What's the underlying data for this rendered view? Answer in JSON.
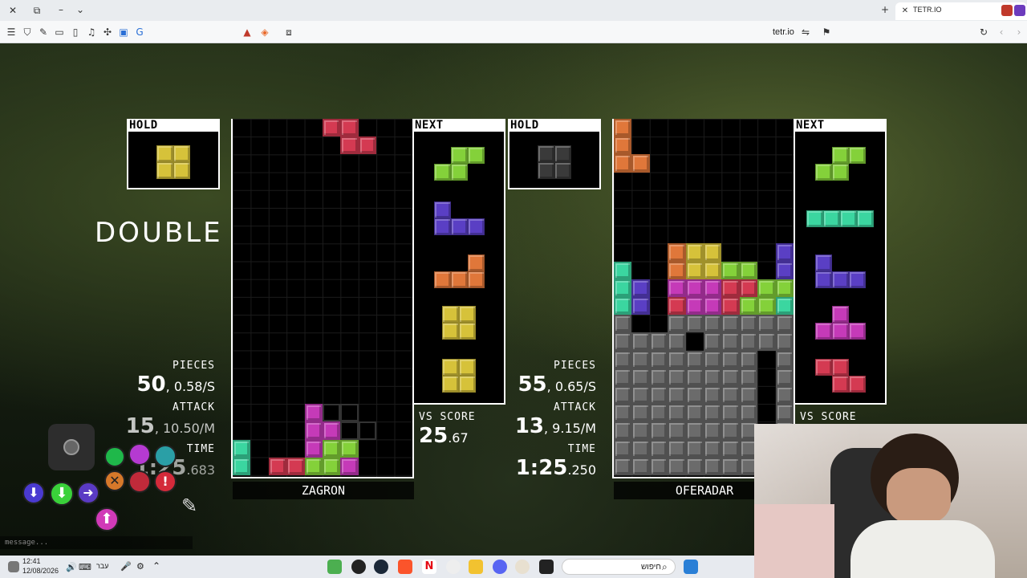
{
  "browser": {
    "tab_title": "TETR.IO",
    "address": "tetr.io"
  },
  "game": {
    "banner": "DOUBLE",
    "colors": {
      "I": "#3bd6a0",
      "J": "#5a3fc4",
      "L": "#e0773a",
      "O": "#d6c23a",
      "S": "#84d13a",
      "T": "#c53ab8",
      "Z": "#d43a52",
      "garbage": "#6b6b6b"
    },
    "player1": {
      "name": "ZAGRON",
      "hold_label": "HOLD",
      "hold_piece": "O",
      "next_label": "NEXT",
      "next": [
        "S",
        "J",
        "L",
        "O",
        "O"
      ],
      "pieces_label": "PIECES",
      "pieces": "50",
      "pieces_rate": "0.58/S",
      "attack_label": "ATTACK",
      "attack": "15",
      "attack_rate": "10.50/M",
      "time_label": "TIME",
      "time": "1:25",
      "time_ms": ".683",
      "vs_label": "VS SCORE",
      "vs": "25",
      "vs_dec": ".67"
    },
    "player2": {
      "name": "OFERADAR",
      "hold_label": "HOLD",
      "hold_piece": "O-disabled",
      "next_label": "NEXT",
      "next": [
        "S",
        "I",
        "J",
        "T",
        "Z"
      ],
      "pieces_label": "PIECES",
      "pieces": "55",
      "pieces_rate": "0.65/S",
      "attack_label": "ATTACK",
      "attack": "13",
      "attack_rate": "9.15/M",
      "time_label": "TIME",
      "time": "1:25",
      "time_ms": ".250",
      "vs_label": "VS SCORE"
    }
  },
  "chat": {
    "placeholder": "message..."
  },
  "taskbar": {
    "time": "12:41",
    "date": "12/08/2026",
    "lang": "עבר",
    "search": "חיפוש"
  }
}
